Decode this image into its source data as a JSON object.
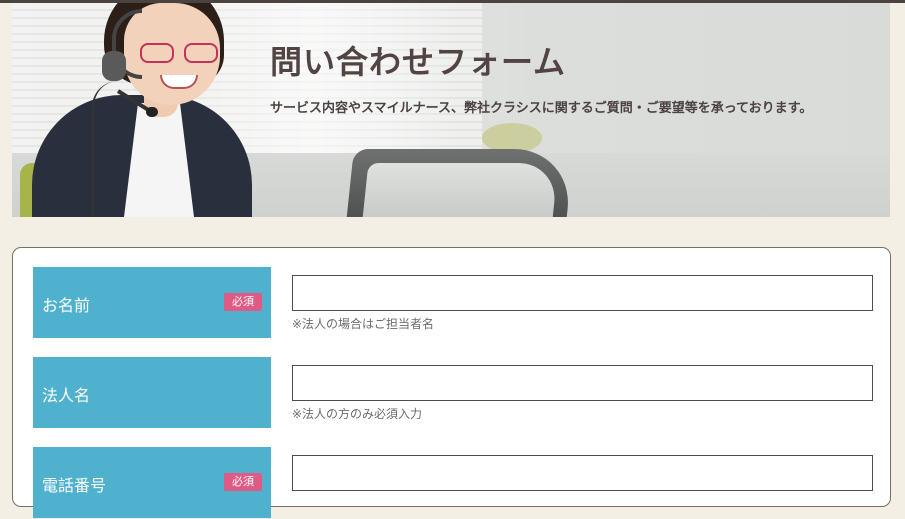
{
  "hero": {
    "title": "問い合わせフォーム",
    "subtitle": "サービス内容やスマイルナース、弊社クラシスに関するご質問・ご要望等を承っております。"
  },
  "form": {
    "fields": [
      {
        "label": "お名前",
        "required_badge": "必須",
        "value": "",
        "note": "※法人の場合はご担当者名"
      },
      {
        "label": "法人名",
        "value": "",
        "note": "※法人の方のみ必須入力"
      },
      {
        "label": "電話番号",
        "required_badge": "必須",
        "value": ""
      }
    ]
  },
  "colors": {
    "label_background": "#4fb1cd",
    "required_badge": "#e05a86",
    "page_background": "#f3efe4",
    "title_text": "#514443"
  }
}
